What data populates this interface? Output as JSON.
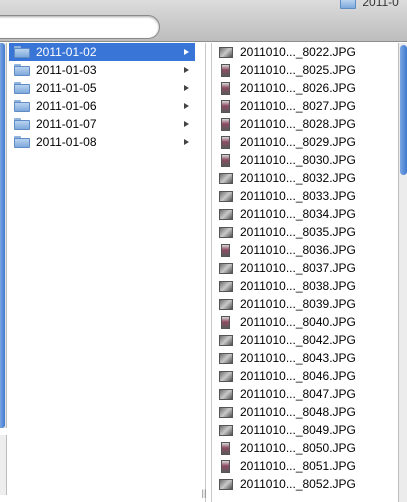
{
  "breadcrumb": {
    "label": "2011-0"
  },
  "folders": [
    {
      "label": "2011-01-02",
      "selected": true
    },
    {
      "label": "2011-01-03",
      "selected": false
    },
    {
      "label": "2011-01-05",
      "selected": false
    },
    {
      "label": "2011-01-06",
      "selected": false
    },
    {
      "label": "2011-01-07",
      "selected": false
    },
    {
      "label": "2011-01-08",
      "selected": false
    }
  ],
  "files": [
    {
      "name": "2011010..._8022.JPG",
      "thumb": "landscape"
    },
    {
      "name": "2011010..._8025.JPG",
      "thumb": "portrait"
    },
    {
      "name": "2011010..._8026.JPG",
      "thumb": "portrait"
    },
    {
      "name": "2011010..._8027.JPG",
      "thumb": "portrait"
    },
    {
      "name": "2011010..._8028.JPG",
      "thumb": "portrait"
    },
    {
      "name": "2011010..._8029.JPG",
      "thumb": "portrait"
    },
    {
      "name": "2011010..._8030.JPG",
      "thumb": "portrait"
    },
    {
      "name": "2011010..._8032.JPG",
      "thumb": "landscape"
    },
    {
      "name": "2011010..._8033.JPG",
      "thumb": "landscape"
    },
    {
      "name": "2011010..._8034.JPG",
      "thumb": "landscape"
    },
    {
      "name": "2011010..._8035.JPG",
      "thumb": "landscape"
    },
    {
      "name": "2011010..._8036.JPG",
      "thumb": "portrait"
    },
    {
      "name": "2011010..._8037.JPG",
      "thumb": "landscape"
    },
    {
      "name": "2011010..._8038.JPG",
      "thumb": "landscape"
    },
    {
      "name": "2011010..._8039.JPG",
      "thumb": "landscape"
    },
    {
      "name": "2011010..._8040.JPG",
      "thumb": "portrait"
    },
    {
      "name": "2011010..._8042.JPG",
      "thumb": "landscape"
    },
    {
      "name": "2011010..._8043.JPG",
      "thumb": "landscape"
    },
    {
      "name": "2011010..._8046.JPG",
      "thumb": "landscape"
    },
    {
      "name": "2011010..._8047.JPG",
      "thumb": "landscape"
    },
    {
      "name": "2011010..._8048.JPG",
      "thumb": "landscape"
    },
    {
      "name": "2011010..._8049.JPG",
      "thumb": "landscape"
    },
    {
      "name": "2011010..._8050.JPG",
      "thumb": "portrait"
    },
    {
      "name": "2011010..._8051.JPG",
      "thumb": "portrait"
    },
    {
      "name": "2011010..._8052.JPG",
      "thumb": "landscape"
    }
  ],
  "colors": {
    "selection": "#3875d7",
    "scroll_knob": "#3f79cf"
  }
}
